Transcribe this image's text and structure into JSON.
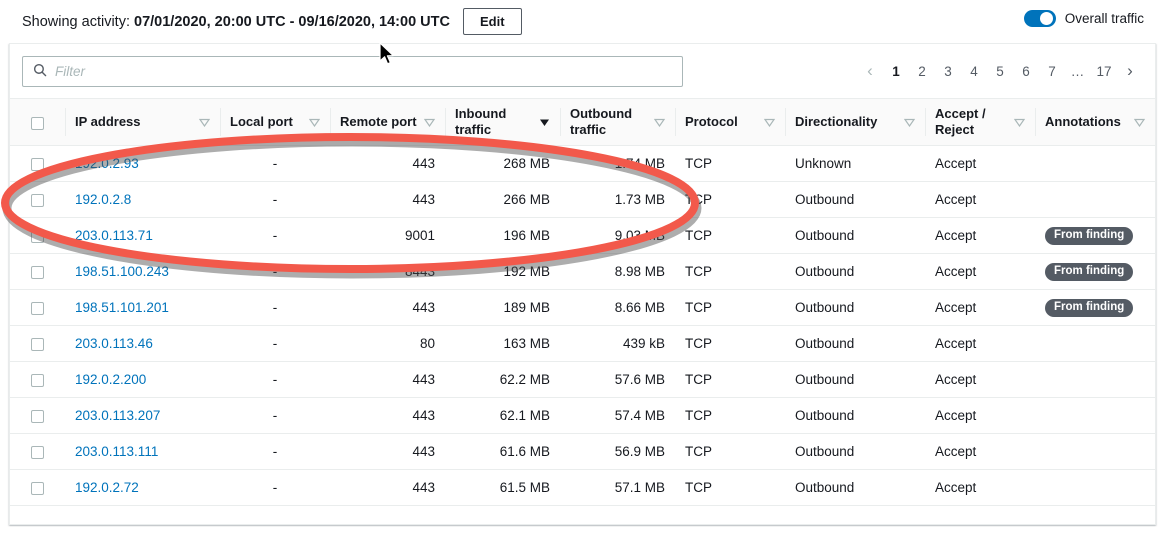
{
  "header": {
    "showing_label": "Showing activity:",
    "date_range": "07/01/2020, 20:00 UTC - 09/16/2020, 14:00 UTC",
    "edit_label": "Edit",
    "toggle_label": "Overall traffic",
    "toggle_on": true,
    "accent_color": "#0073bb"
  },
  "toolbar": {
    "filter_placeholder": "Filter",
    "filter_value": "",
    "search_icon": "search-icon"
  },
  "pagination": {
    "prev_label": "‹",
    "next_label": "›",
    "pages": [
      "1",
      "2",
      "3",
      "4",
      "5",
      "6",
      "7",
      "…",
      "17"
    ],
    "current": "1"
  },
  "table": {
    "columns": [
      {
        "label": "IP address",
        "sort": "none",
        "align": "left"
      },
      {
        "label": "Local port",
        "sort": "none",
        "align": "left"
      },
      {
        "label": "Remote port",
        "sort": "none",
        "align": "right"
      },
      {
        "label": "Inbound traffic",
        "sort": "desc",
        "align": "right"
      },
      {
        "label": "Outbound traffic",
        "sort": "none",
        "align": "right"
      },
      {
        "label": "Protocol",
        "sort": "none",
        "align": "left"
      },
      {
        "label": "Directionality",
        "sort": "none",
        "align": "left"
      },
      {
        "label": "Accept / Reject",
        "sort": "none",
        "align": "left"
      },
      {
        "label": "Annotations",
        "sort": "none",
        "align": "left"
      }
    ],
    "rows": [
      {
        "ip": "192.0.2.93",
        "local_port": "-",
        "remote_port": "443",
        "inbound": "268 MB",
        "outbound": "1.74 MB",
        "protocol": "TCP",
        "directionality": "Unknown",
        "accept_reject": "Accept",
        "annotation": ""
      },
      {
        "ip": "192.0.2.8",
        "local_port": "-",
        "remote_port": "443",
        "inbound": "266 MB",
        "outbound": "1.73 MB",
        "protocol": "TCP",
        "directionality": "Outbound",
        "accept_reject": "Accept",
        "annotation": ""
      },
      {
        "ip": "203.0.113.71",
        "local_port": "-",
        "remote_port": "9001",
        "inbound": "196 MB",
        "outbound": "9.03 MB",
        "protocol": "TCP",
        "directionality": "Outbound",
        "accept_reject": "Accept",
        "annotation": "From finding"
      },
      {
        "ip": "198.51.100.243",
        "local_port": "-",
        "remote_port": "8443",
        "inbound": "192 MB",
        "outbound": "8.98 MB",
        "protocol": "TCP",
        "directionality": "Outbound",
        "accept_reject": "Accept",
        "annotation": "From finding"
      },
      {
        "ip": "198.51.101.201",
        "local_port": "-",
        "remote_port": "443",
        "inbound": "189 MB",
        "outbound": "8.66 MB",
        "protocol": "TCP",
        "directionality": "Outbound",
        "accept_reject": "Accept",
        "annotation": "From finding"
      },
      {
        "ip": "203.0.113.46",
        "local_port": "-",
        "remote_port": "80",
        "inbound": "163 MB",
        "outbound": "439 kB",
        "protocol": "TCP",
        "directionality": "Outbound",
        "accept_reject": "Accept",
        "annotation": ""
      },
      {
        "ip": "192.0.2.200",
        "local_port": "-",
        "remote_port": "443",
        "inbound": "62.2 MB",
        "outbound": "57.6 MB",
        "protocol": "TCP",
        "directionality": "Outbound",
        "accept_reject": "Accept",
        "annotation": ""
      },
      {
        "ip": "203.0.113.207",
        "local_port": "-",
        "remote_port": "443",
        "inbound": "62.1 MB",
        "outbound": "57.4 MB",
        "protocol": "TCP",
        "directionality": "Outbound",
        "accept_reject": "Accept",
        "annotation": ""
      },
      {
        "ip": "203.0.113.111",
        "local_port": "-",
        "remote_port": "443",
        "inbound": "61.6 MB",
        "outbound": "56.9 MB",
        "protocol": "TCP",
        "directionality": "Outbound",
        "accept_reject": "Accept",
        "annotation": ""
      },
      {
        "ip": "192.0.2.72",
        "local_port": "-",
        "remote_port": "443",
        "inbound": "61.5 MB",
        "outbound": "57.1 MB",
        "protocol": "TCP",
        "directionality": "Outbound",
        "accept_reject": "Accept",
        "annotation": ""
      }
    ]
  },
  "annotation_overlay": {
    "shape": "ellipse",
    "color": "#f2594b"
  }
}
